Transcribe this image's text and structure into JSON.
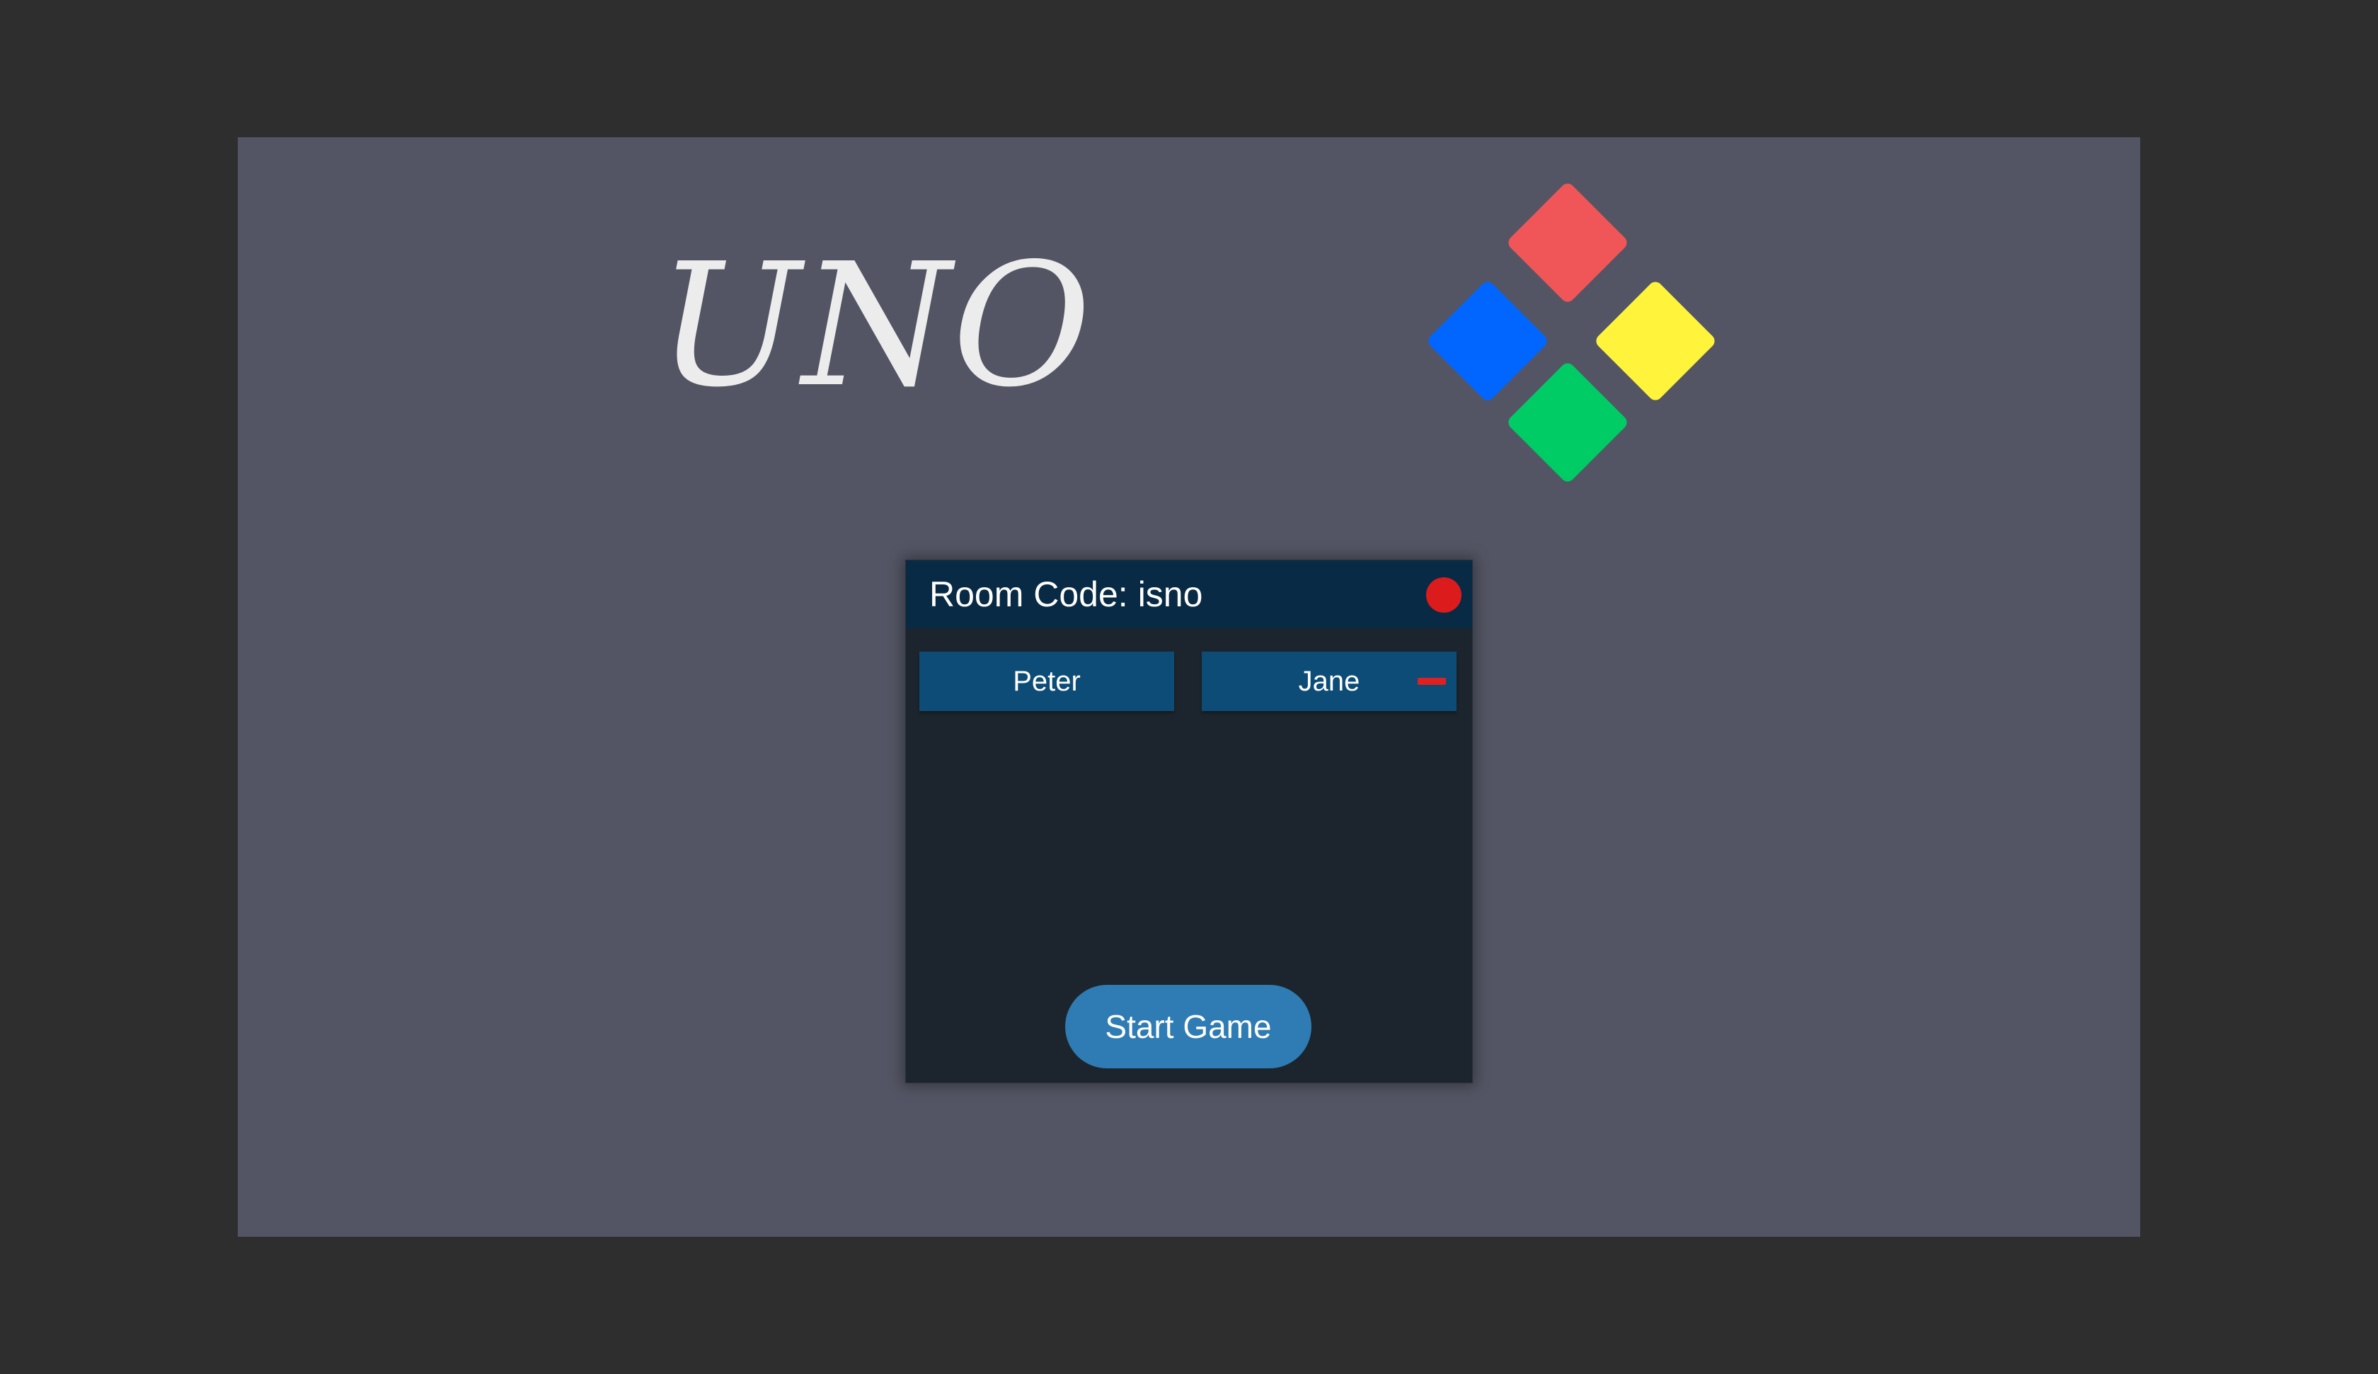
{
  "game": {
    "title": "UNO"
  },
  "logo": {
    "colors": {
      "red": "#f05657",
      "blue": "#0066ff",
      "yellow": "#fff43b",
      "green": "#00cc66"
    }
  },
  "room": {
    "code_label": "Room Code:",
    "code_value": "isno",
    "status_color": "#dc1c1c",
    "players": [
      {
        "name": "Peter",
        "removable": false
      },
      {
        "name": "Jane",
        "removable": true
      }
    ],
    "start_button_label": "Start Game"
  }
}
